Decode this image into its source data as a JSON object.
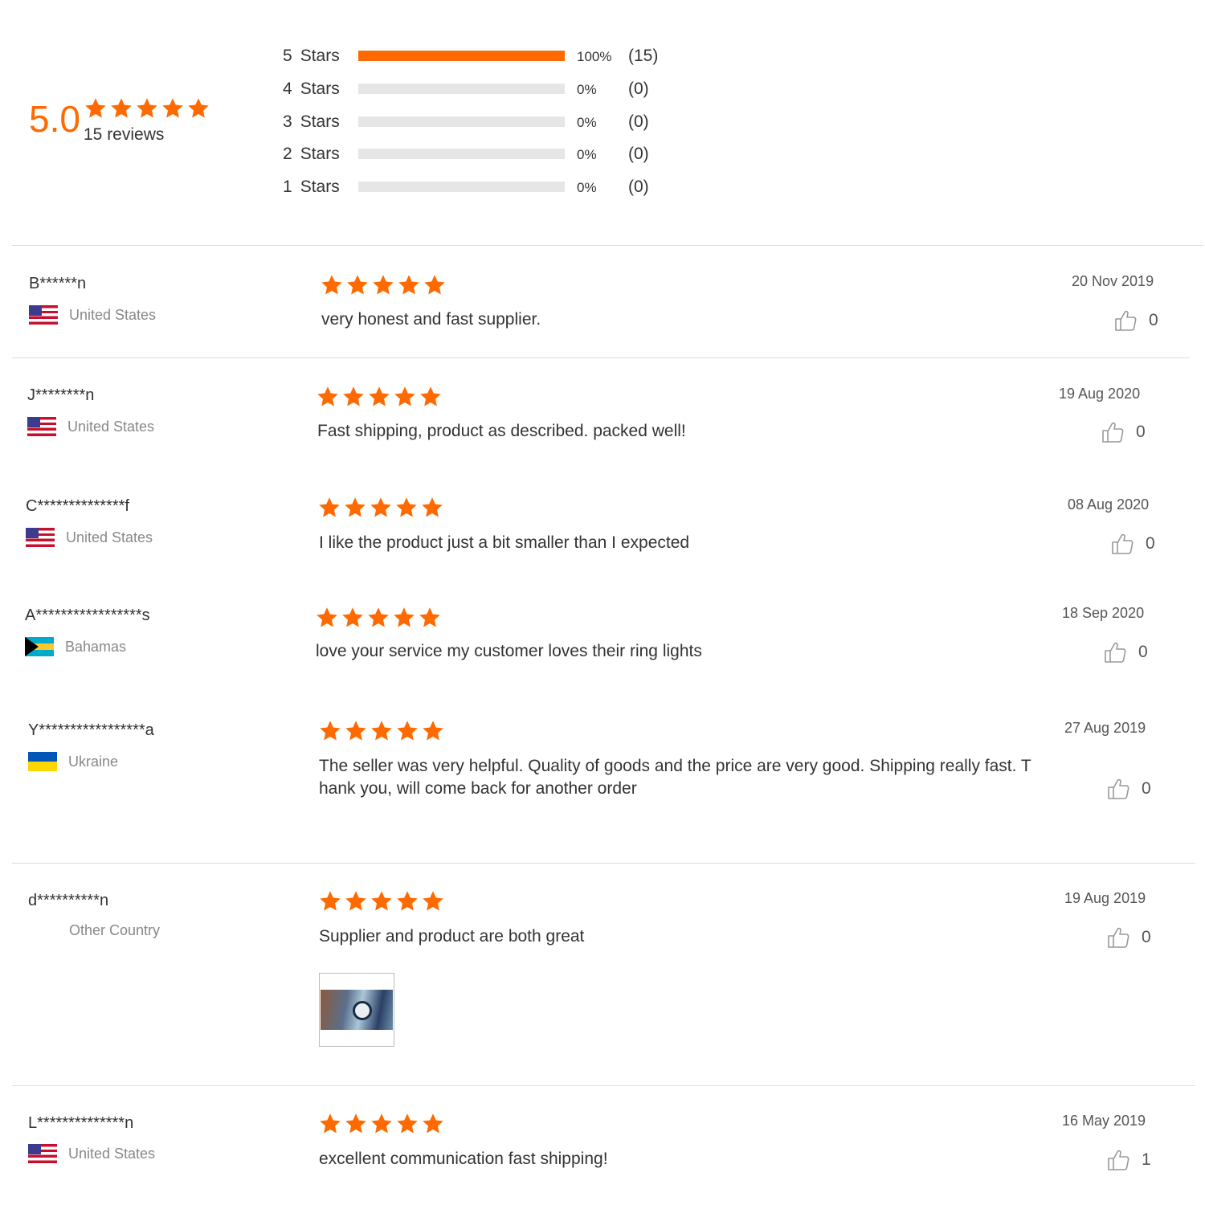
{
  "accent_color": "#ff6a00",
  "summary": {
    "average": "5.0",
    "average_stars": 5,
    "review_count_label": "15 reviews",
    "distribution": [
      {
        "star": "5",
        "label": "Stars",
        "fraction": 1.0,
        "percent": "100%",
        "count": "(15)"
      },
      {
        "star": "4",
        "label": "Stars",
        "fraction": 0.0,
        "percent": "0%",
        "count": "(0)"
      },
      {
        "star": "3",
        "label": "Stars",
        "fraction": 0.0,
        "percent": "0%",
        "count": "(0)"
      },
      {
        "star": "2",
        "label": "Stars",
        "fraction": 0.0,
        "percent": "0%",
        "count": "(0)"
      },
      {
        "star": "1",
        "label": "Stars",
        "fraction": 0.0,
        "percent": "0%",
        "count": "(0)"
      }
    ]
  },
  "reviews": [
    {
      "name": "B******n",
      "country": "United States",
      "flag": "us-flag-icon",
      "rating": 5,
      "text": "very honest and fast supplier.",
      "date": "20 Nov 2019",
      "likes": "0"
    },
    {
      "name": "J********n",
      "country": "United States",
      "flag": "us-flag-icon",
      "rating": 5,
      "text": "Fast shipping, product as described. packed well!",
      "date": "19 Aug 2020",
      "likes": "0"
    },
    {
      "name": "C**************f",
      "country": "United States",
      "flag": "us-flag-icon",
      "rating": 5,
      "text": "I like the product just a bit smaller than I expected",
      "date": "08 Aug 2020",
      "likes": "0"
    },
    {
      "name": "A*****************s",
      "country": "Bahamas",
      "flag": "bahamas-flag-icon",
      "rating": 5,
      "text": "love your service my customer loves their ring lights",
      "date": "18 Sep 2020",
      "likes": "0"
    },
    {
      "name": "Y*****************a",
      "country": "Ukraine",
      "flag": "ukraine-flag-icon",
      "rating": 5,
      "text": "The seller was very helpful. Quality of goods and the price are very good. Shipping really fast. Thank you, will come back for another order",
      "date": "27 Aug 2019",
      "likes": "0"
    },
    {
      "name": "d**********n",
      "country": "Other Country",
      "flag": "",
      "rating": 5,
      "text": "Supplier and product are both great",
      "date": "19 Aug 2019",
      "likes": "0",
      "has_photo": true
    },
    {
      "name": "L**************n",
      "country": "United States",
      "flag": "us-flag-icon",
      "rating": 5,
      "text": "excellent communication fast shipping!",
      "date": "16 May 2019",
      "likes": "1"
    }
  ]
}
